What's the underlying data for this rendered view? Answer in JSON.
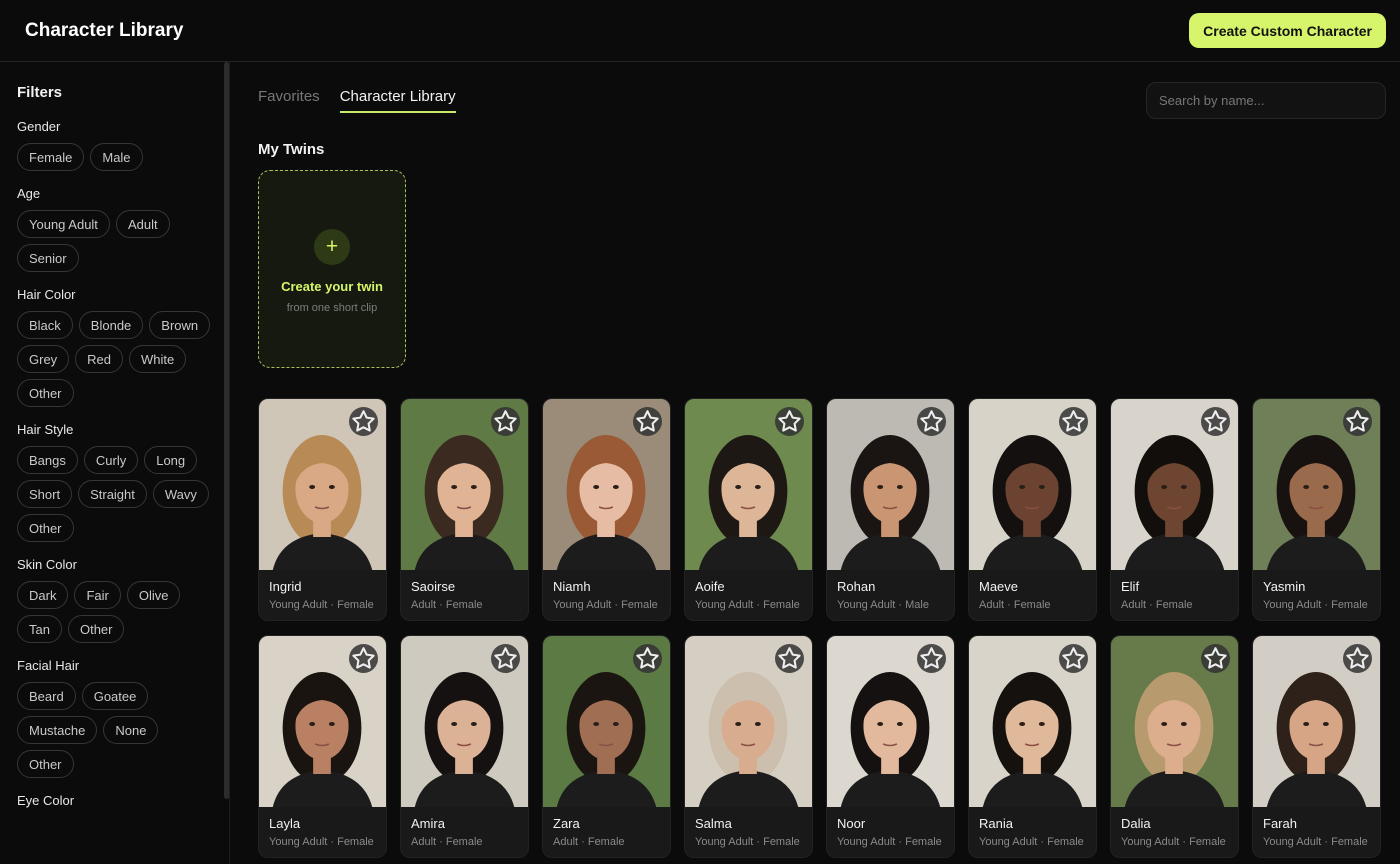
{
  "header": {
    "title": "Character Library",
    "create_label": "Create Custom Character"
  },
  "filters": {
    "title": "Filters",
    "groups": [
      {
        "title": "Gender",
        "options": [
          "Female",
          "Male"
        ]
      },
      {
        "title": "Age",
        "options": [
          "Young Adult",
          "Adult",
          "Senior"
        ]
      },
      {
        "title": "Hair Color",
        "options": [
          "Black",
          "Blonde",
          "Brown",
          "Grey",
          "Red",
          "White",
          "Other"
        ]
      },
      {
        "title": "Hair Style",
        "options": [
          "Bangs",
          "Curly",
          "Long",
          "Short",
          "Straight",
          "Wavy",
          "Other"
        ]
      },
      {
        "title": "Skin Color",
        "options": [
          "Dark",
          "Fair",
          "Olive",
          "Tan",
          "Other"
        ]
      },
      {
        "title": "Facial Hair",
        "options": [
          "Beard",
          "Goatee",
          "Mustache",
          "None",
          "Other"
        ]
      },
      {
        "title": "Eye Color",
        "options": []
      }
    ]
  },
  "tabs": [
    {
      "label": "Favorites",
      "active": false
    },
    {
      "label": "Character Library",
      "active": true
    }
  ],
  "search": {
    "placeholder": "Search by name..."
  },
  "twins": {
    "title": "My Twins",
    "create_title": "Create your twin",
    "create_sub": "from one short clip"
  },
  "characters": [
    {
      "name": "Ingrid",
      "meta": "Young Adult · Female",
      "bg": "#cfc6b8",
      "skin": "#d9a985",
      "hair": "#b88a55"
    },
    {
      "name": "Saoirse",
      "meta": "Adult · Female",
      "bg": "#5f7a45",
      "skin": "#e0b394",
      "hair": "#3a2a1f"
    },
    {
      "name": "Niamh",
      "meta": "Young Adult · Female",
      "bg": "#9b8c7a",
      "skin": "#e7bca4",
      "hair": "#9a5a35"
    },
    {
      "name": "Aoife",
      "meta": "Young Adult · Female",
      "bg": "#6f8a4e",
      "skin": "#ddb597",
      "hair": "#1e1814"
    },
    {
      "name": "Rohan",
      "meta": "Young Adult · Male",
      "bg": "#bdbab3",
      "skin": "#c99572",
      "hair": "#1a1512"
    },
    {
      "name": "Maeve",
      "meta": "Adult · Female",
      "bg": "#d8d3c9",
      "skin": "#6b4330",
      "hair": "#141010"
    },
    {
      "name": "Elif",
      "meta": "Adult · Female",
      "bg": "#d9d4cb",
      "skin": "#6e4530",
      "hair": "#120e0c"
    },
    {
      "name": "Yasmin",
      "meta": "Young Adult · Female",
      "bg": "#6f7f58",
      "skin": "#9a6a4c",
      "hair": "#17120f"
    },
    {
      "name": "Layla",
      "meta": "Young Adult · Female",
      "bg": "#d8d2c7",
      "skin": "#b98063",
      "hair": "#1a1411"
    },
    {
      "name": "Amira",
      "meta": "Adult · Female",
      "bg": "#cfcac0",
      "skin": "#dcb296",
      "hair": "#141110"
    },
    {
      "name": "Zara",
      "meta": "Adult · Female",
      "bg": "#5c7a44",
      "skin": "#a06e52",
      "hair": "#1b1512"
    },
    {
      "name": "Salma",
      "meta": "Young Adult · Female",
      "bg": "#d5cfc3",
      "skin": "#d8ac8e",
      "hair": "#cdbfae"
    },
    {
      "name": "Noor",
      "meta": "Young Adult · Female",
      "bg": "#dcd8d0",
      "skin": "#e2b99c",
      "hair": "#141110"
    },
    {
      "name": "Rania",
      "meta": "Young Adult · Female",
      "bg": "#d9d4ca",
      "skin": "#e0b89a",
      "hair": "#15110e"
    },
    {
      "name": "Dalia",
      "meta": "Young Adult · Female",
      "bg": "#667a4a",
      "skin": "#dcae8e",
      "hair": "#b79a6e"
    },
    {
      "name": "Farah",
      "meta": "Young Adult · Female",
      "bg": "#d3cec5",
      "skin": "#d6a585",
      "hair": "#2e2119"
    }
  ]
}
